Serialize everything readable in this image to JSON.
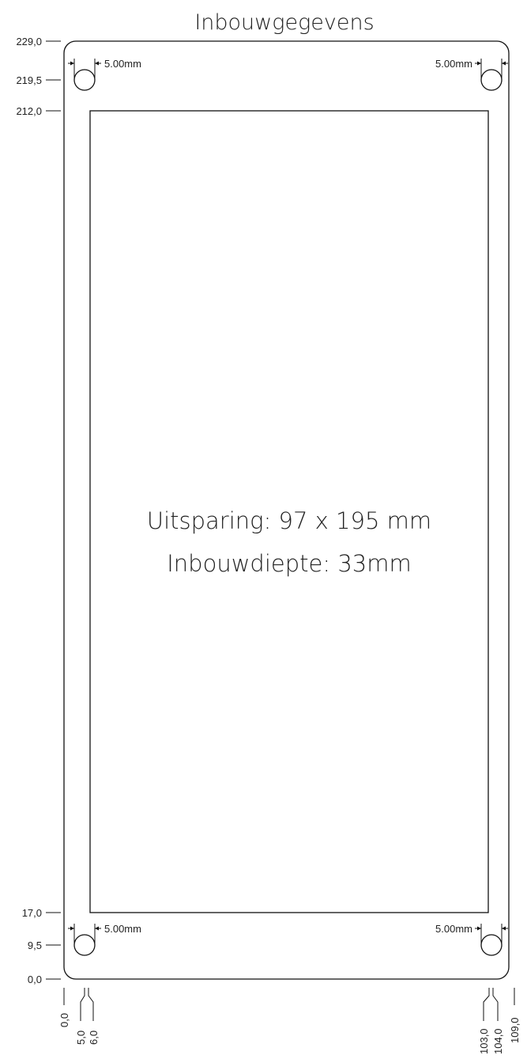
{
  "title": "Inbouwgegevens",
  "info": {
    "cutout": "Uitsparing: 97 x 195 mm",
    "depth": "Inbouwdiepte: 33mm"
  },
  "hole_dimension_label": "5.00mm",
  "y_labels": [
    "229,0",
    "219,5",
    "212,0",
    "17,0",
    "9,5",
    "0,0"
  ],
  "x_labels": [
    "0,0",
    "5,0",
    "6,0",
    "103,0",
    "104,0",
    "109,0"
  ],
  "colors": {
    "line": "#111111",
    "text": "#222222",
    "background": "#ffffff"
  }
}
